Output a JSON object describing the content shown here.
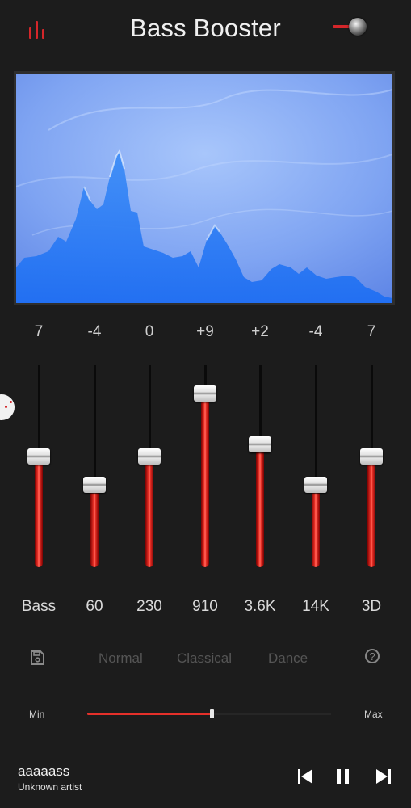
{
  "header": {
    "title": "Bass Booster",
    "eq_icon": "equalizer-bars-icon",
    "power_icon": "power-toggle-icon",
    "accent": "#d4262a"
  },
  "visualizer": {
    "type": "spectrum-area"
  },
  "equalizer": {
    "bands": [
      {
        "label": "Bass",
        "value": "7",
        "level": 0.55
      },
      {
        "label": "60",
        "value": "-4",
        "level": 0.41
      },
      {
        "label": "230",
        "value": "0",
        "level": 0.55
      },
      {
        "label": "910",
        "value": "+9",
        "level": 0.86
      },
      {
        "label": "3.6K",
        "value": "+2",
        "level": 0.61
      },
      {
        "label": "14K",
        "value": "-4",
        "level": 0.41
      },
      {
        "label": "3D",
        "value": "7",
        "level": 0.55
      }
    ]
  },
  "presets": {
    "save_icon": "save-icon",
    "items": [
      "Normal",
      "Classical",
      "Dance"
    ],
    "help_icon": "help-icon",
    "help_glyph": "?"
  },
  "boost": {
    "min_label": "Min",
    "max_label": "Max",
    "level": 0.51
  },
  "player": {
    "title": "aaaaass",
    "artist": "Unknown artist",
    "prev_icon": "skip-previous-icon",
    "pause_icon": "pause-icon",
    "next_icon": "skip-next-icon"
  }
}
